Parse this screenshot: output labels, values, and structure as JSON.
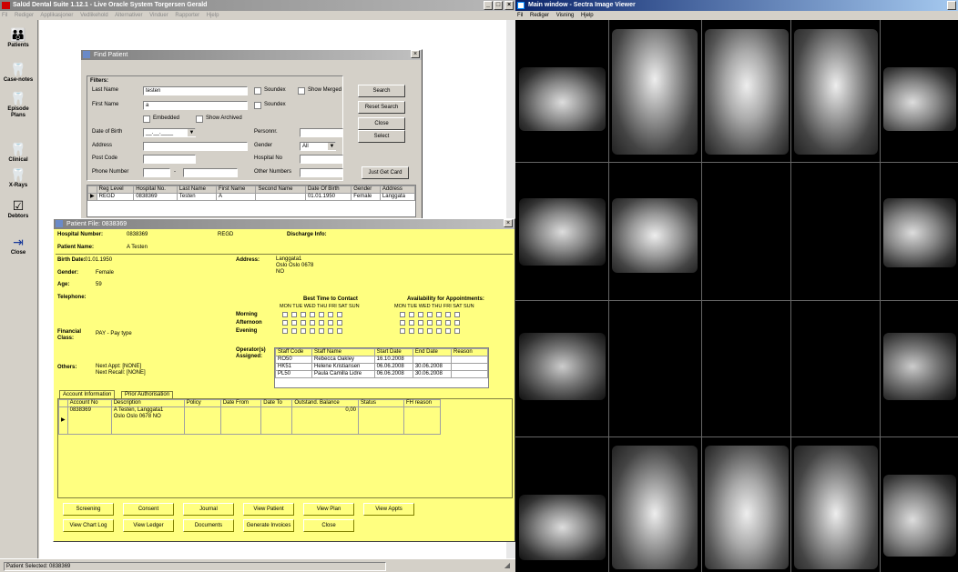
{
  "left_window": {
    "title": "Salüd Dental Suite 1.12.1 - Live Oracle System Torgersen Gerald",
    "menu": [
      "Fil",
      "Rediger",
      "Applikasjoner",
      "Vedlikehold",
      "Alternativer",
      "Vinduer",
      "Rapporter",
      "Hjelp"
    ],
    "win_buttons": [
      "_",
      "□",
      "×"
    ],
    "status_text": "Patient Selected: 0838369"
  },
  "sidebar": {
    "items": [
      {
        "label": "Patients",
        "icon": "👪"
      },
      {
        "label": "Case-notes",
        "icon": "🦷"
      },
      {
        "label": "Episode Plans",
        "icon": "🦷"
      },
      {
        "label": "Clinical",
        "icon": "🦷"
      },
      {
        "label": "X-Rays",
        "icon": "🦷"
      },
      {
        "label": "Debtors",
        "icon": "☑"
      },
      {
        "label": "Close",
        "icon": "⇥"
      }
    ]
  },
  "find": {
    "title": "Find Patient",
    "close": "×",
    "filters_label": "Filters:",
    "last_name_label": "Last Name",
    "last_name": "testen",
    "first_name_label": "First Name",
    "first_name": "a",
    "soundex1": "Soundex",
    "soundex2": "Soundex",
    "show_merged": "Show Merged",
    "embedded": "Embedded",
    "show_archived": "Show Archived",
    "dob_label": "Date of Birth",
    "dob": "__.__.____",
    "personnr_label": "Personnr.",
    "address_label": "Address",
    "gender_label": "Gender",
    "gender": "All",
    "postcode_label": "Post Code",
    "hospital_label": "Hospital No",
    "phone_label": "Phone Number",
    "phone_sep": "-",
    "other_label": "Other Numbers",
    "btn_search": "Search",
    "btn_reset": "Reset Search",
    "btn_close": "Close",
    "btn_select": "Select",
    "btn_card": "Just Get Card",
    "columns": [
      "Reg Level",
      "Hospital No.",
      "Last Name",
      "First Name",
      "Second Name",
      "Date Of Birth",
      "Gender",
      "Address"
    ],
    "rows": [
      [
        "REGD",
        "0838369",
        "Testen",
        "A",
        "",
        "01.01.1950",
        "Female",
        "Langgata"
      ]
    ]
  },
  "file": {
    "title": "Patient File: 0838369",
    "close": "×",
    "hospital_label": "Hospital Number:",
    "hospital": "0838369",
    "reg": "REGD",
    "discharge_label": "Discharge Info:",
    "name_label": "Patient Name:",
    "name": "A Testen",
    "birth_label": "Birth Date:",
    "birth": "01.01.1950",
    "gender_label": "Gender:",
    "gender": "Female",
    "age_label": "Age:",
    "age": "59",
    "tel_label": "Telephone:",
    "address_label": "Address:",
    "address_lines": [
      "Langgata1",
      "Oslo Oslo 0678",
      "NO"
    ],
    "best_label": "Best Time to Contact",
    "avail_label": "Availability for Appointments:",
    "days": "MON TUE WED THU FRI  SAT  SUN",
    "rows": [
      "Morning",
      "Afternoon",
      "Evening"
    ],
    "financial_label": "Financial Class:",
    "financial": "PAY - Pay type",
    "operators_label": "Operator(s) Assigned:",
    "op_cols": [
      "Staff Code",
      "Staff Name",
      "Start Date",
      "End Date",
      "Reason"
    ],
    "op_rows": [
      [
        "RO50",
        "Rebecca Oakley",
        "16.10.2008",
        "",
        ""
      ],
      [
        "HK51",
        "Helene Kristiansen",
        "06.06.2008",
        "30.06.2008",
        ""
      ],
      [
        "PL50",
        "Paula Camilla Lidre",
        "06.06.2008",
        "30.06.2008",
        ""
      ]
    ],
    "others_label": "Others:",
    "next_appt": "Next Appt: [NONE]",
    "next_recall": "Next Recall: [NONE]",
    "tabs": [
      "Account Information",
      "Prior Authorisation"
    ],
    "acc_cols": [
      "Account No",
      "Description",
      "Policy",
      "Date From",
      "Date To",
      "Outstand. Balance",
      "Status",
      "FH reason"
    ],
    "acc_rows": [
      [
        "0838369",
        "A Testen, Langgata1\nOslo Oslo 0678 NO",
        "",
        "",
        "",
        "0,00",
        "",
        ""
      ]
    ],
    "buttons_row1": [
      "Screening",
      "Consent",
      "Journal",
      "View Patient",
      "View Plan",
      "View Appts"
    ],
    "buttons_row2": [
      "View Chart Log",
      "View Ledger",
      "Documents",
      "Generate Invoices",
      "Close"
    ]
  },
  "viewer": {
    "title": "Main window - Sectra Image Viewer",
    "menu": [
      "Fil",
      "Rediger",
      "Visning",
      "Hjelp"
    ]
  }
}
